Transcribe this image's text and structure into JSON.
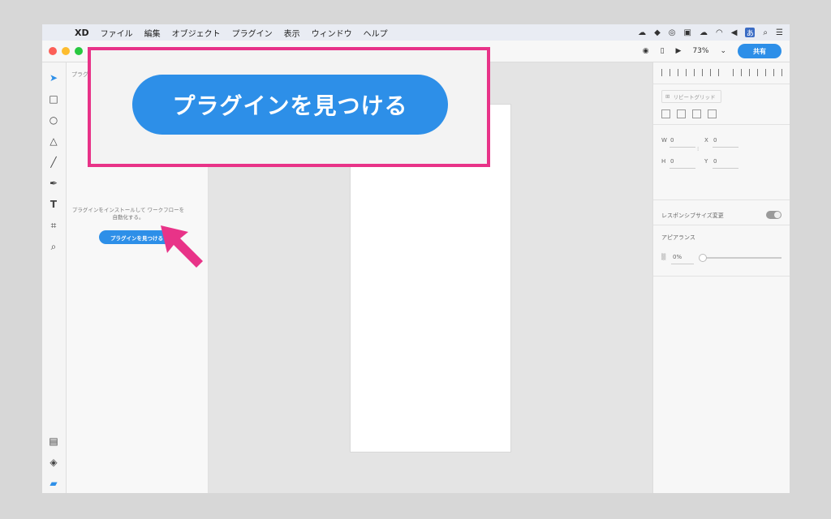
{
  "menubar": {
    "app_name": "XD",
    "items": [
      "ファイル",
      "編集",
      "オブジェクト",
      "プラグイン",
      "表示",
      "ウィンドウ",
      "ヘルプ"
    ],
    "ime_label": "あ"
  },
  "toolbar": {
    "zoom": "73%",
    "share_label": "共有"
  },
  "plugins_panel": {
    "title": "プラグ",
    "description": "プラグインをインストールして ワークフローを自動化する。",
    "find_button": "プラグインを見つける"
  },
  "callout": {
    "button_label": "プラグインを見つける"
  },
  "inspector": {
    "repeat_grid_label": "リピートグリッド",
    "w_label": "W",
    "w_value": "0",
    "h_label": "H",
    "h_value": "0",
    "x_label": "X",
    "x_value": "0",
    "y_label": "Y",
    "y_value": "0",
    "responsive_label": "レスポンシブサイズ変更",
    "appearance_label": "アピアランス",
    "opacity_value": "0%"
  },
  "colors": {
    "accent": "#2d8fe8",
    "highlight": "#e83388"
  }
}
